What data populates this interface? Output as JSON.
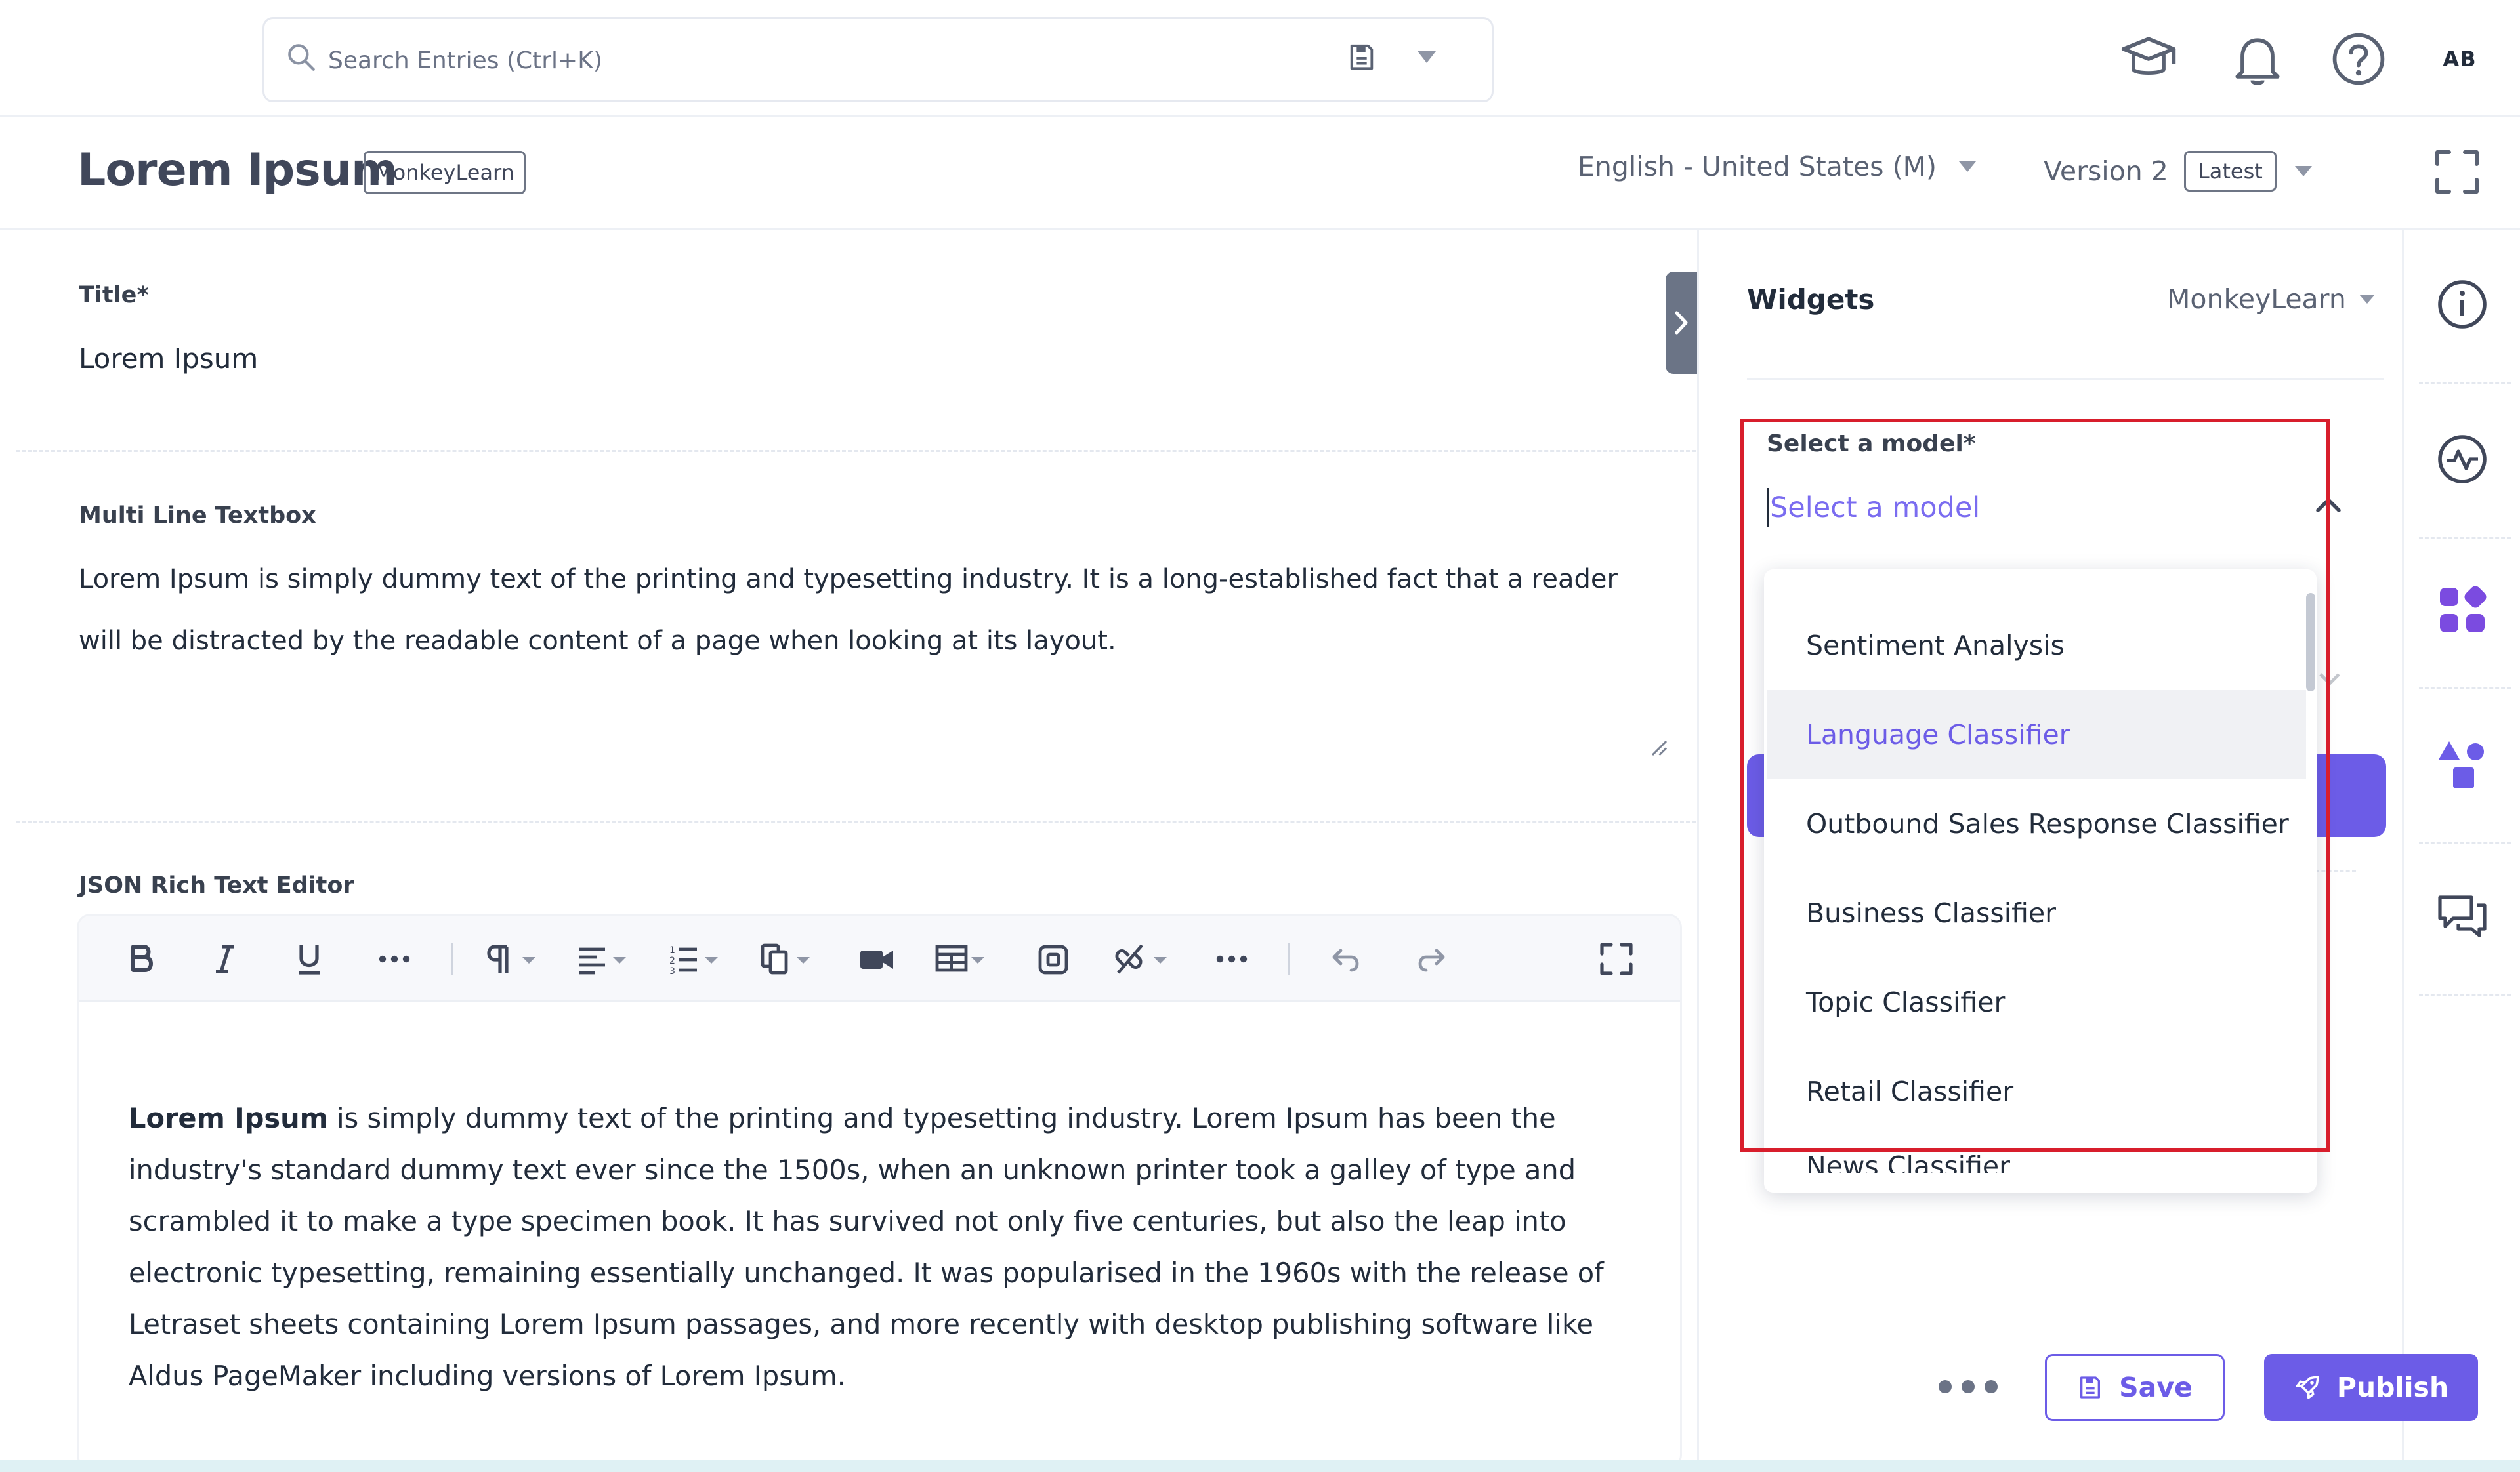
{
  "search": {
    "placeholder": "Search Entries (Ctrl+K)"
  },
  "user": {
    "initials": "AB"
  },
  "entry": {
    "title": "Lorem Ipsum",
    "badge": "MonkeyLearn",
    "locale": "English - United States (M)",
    "version": "Version 2",
    "version_badge": "Latest"
  },
  "fields": {
    "title": {
      "label": "Title*",
      "value": "Lorem Ipsum"
    },
    "multi_line": {
      "label": "Multi Line Textbox",
      "value": "Lorem Ipsum is simply dummy text of the printing and typesetting industry. It is a long-established fact that a reader will be distracted by the readable content of a page when looking at its layout."
    },
    "rich_text": {
      "label": "JSON Rich Text Editor",
      "bold_lead": "Lorem Ipsum",
      "body": " is simply dummy text of the printing and typesetting industry. Lorem Ipsum has been the industry's standard dummy text ever since the 1500s, when an unknown printer took a galley of type and scrambled it to make a type specimen book. It has survived not only five centuries, but also the leap into electronic typesetting, remaining essentially unchanged. It was popularised in the 1960s with the release of Letraset sheets containing Lorem Ipsum passages, and more recently with desktop publishing software like Aldus PageMaker including versions of Lorem Ipsum."
    }
  },
  "widgets": {
    "title": "Widgets",
    "app": "MonkeyLearn",
    "model_label": "Select a model*",
    "model_placeholder": "Select a model",
    "options": [
      "Sentiment Analysis",
      "Language Classifier",
      "Outbound Sales Response Classifier",
      "Business Classifier",
      "Topic Classifier",
      "Retail Classifier",
      "News Classifier"
    ],
    "hovered_option": "Language Classifier"
  },
  "actions": {
    "save": "Save",
    "publish": "Publish"
  },
  "colors": {
    "accent": "#6c5ce7",
    "highlight": "#d81e2c",
    "text": "#222c3b"
  }
}
